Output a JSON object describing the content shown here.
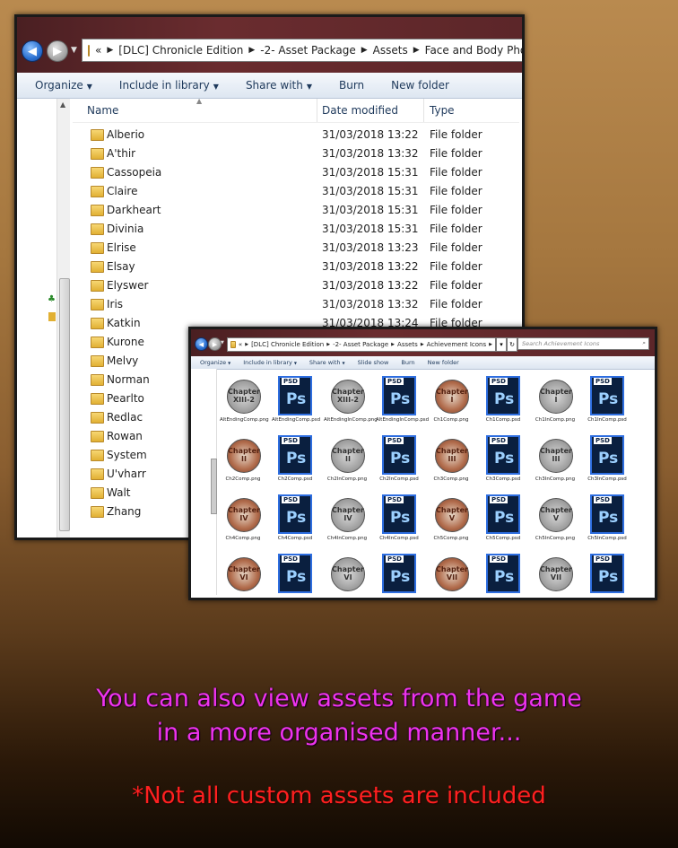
{
  "window1": {
    "path": [
      "«",
      "[DLC] Chronicle Edition",
      "-2- Asset Package",
      "Assets",
      "Face and Body Photos"
    ],
    "toolbar": [
      "Organize",
      "Include in library",
      "Share with",
      "Burn",
      "New folder"
    ],
    "columns": {
      "name": "Name",
      "date": "Date modified",
      "type": "Type"
    },
    "rows": [
      {
        "name": "Alberio",
        "date": "31/03/2018 13:22",
        "type": "File folder"
      },
      {
        "name": "A'thir",
        "date": "31/03/2018 13:32",
        "type": "File folder"
      },
      {
        "name": "Cassopeia",
        "date": "31/03/2018 15:31",
        "type": "File folder"
      },
      {
        "name": "Claire",
        "date": "31/03/2018 15:31",
        "type": "File folder"
      },
      {
        "name": "Darkheart",
        "date": "31/03/2018 15:31",
        "type": "File folder"
      },
      {
        "name": "Divinia",
        "date": "31/03/2018 15:31",
        "type": "File folder"
      },
      {
        "name": "Elrise",
        "date": "31/03/2018 13:23",
        "type": "File folder"
      },
      {
        "name": "Elsay",
        "date": "31/03/2018 13:22",
        "type": "File folder"
      },
      {
        "name": "Elyswer",
        "date": "31/03/2018 13:22",
        "type": "File folder"
      },
      {
        "name": "Iris",
        "date": "31/03/2018 13:32",
        "type": "File folder"
      },
      {
        "name": "Katkin",
        "date": "31/03/2018 13:24",
        "type": "File folder"
      },
      {
        "name": "Kurone",
        "date": "",
        "type": ""
      },
      {
        "name": "Melvy",
        "date": "",
        "type": ""
      },
      {
        "name": "Norman",
        "date": "",
        "type": ""
      },
      {
        "name": "Pearlto",
        "date": "",
        "type": ""
      },
      {
        "name": "Redlac",
        "date": "",
        "type": ""
      },
      {
        "name": "Rowan",
        "date": "",
        "type": ""
      },
      {
        "name": "System",
        "date": "",
        "type": ""
      },
      {
        "name": "U'vharr",
        "date": "",
        "type": ""
      },
      {
        "name": "Walt",
        "date": "",
        "type": ""
      },
      {
        "name": "Zhang",
        "date": "",
        "type": ""
      }
    ]
  },
  "window2": {
    "path": [
      "«",
      "[DLC] Chronicle Edition",
      "-2- Asset Package",
      "Assets",
      "Achievement Icons"
    ],
    "search_placeholder": "Search Achievement Icons",
    "toolbar": [
      "Organize",
      "Include in library",
      "Share with",
      "Slide show",
      "Burn",
      "New folder"
    ],
    "tiles": [
      {
        "kind": "chapter",
        "text": "Chapter XIII-2",
        "label": "AltEndingComp.png",
        "tone": "gray"
      },
      {
        "kind": "psd",
        "label": "AltEndingComp.psd"
      },
      {
        "kind": "chapter",
        "text": "Chapter XIII-2",
        "label": "AltEndingInComp.png",
        "tone": "gray"
      },
      {
        "kind": "psd",
        "label": "AltEndingInComp.psd"
      },
      {
        "kind": "chapter",
        "text": "Chapter I",
        "label": "Ch1Comp.png",
        "tone": "red"
      },
      {
        "kind": "psd",
        "label": "Ch1Comp.psd"
      },
      {
        "kind": "chapter",
        "text": "Chapter I",
        "label": "Ch1InComp.png",
        "tone": "gray"
      },
      {
        "kind": "psd",
        "label": "Ch1InComp.psd"
      },
      {
        "kind": "chapter",
        "text": "Chapter II",
        "label": "Ch2Comp.png",
        "tone": "red"
      },
      {
        "kind": "psd",
        "label": "Ch2Comp.psd"
      },
      {
        "kind": "chapter",
        "text": "Chapter II",
        "label": "Ch2InComp.png",
        "tone": "gray"
      },
      {
        "kind": "psd",
        "label": "Ch2InComp.psd"
      },
      {
        "kind": "chapter",
        "text": "Chapter III",
        "label": "Ch3Comp.png",
        "tone": "red"
      },
      {
        "kind": "psd",
        "label": "Ch3Comp.psd"
      },
      {
        "kind": "chapter",
        "text": "Chapter III",
        "label": "Ch3InComp.png",
        "tone": "gray"
      },
      {
        "kind": "psd",
        "label": "Ch3InComp.psd"
      },
      {
        "kind": "chapter",
        "text": "Chapter IV",
        "label": "Ch4Comp.png",
        "tone": "red"
      },
      {
        "kind": "psd",
        "label": "Ch4Comp.psd"
      },
      {
        "kind": "chapter",
        "text": "Chapter IV",
        "label": "Ch4InComp.png",
        "tone": "gray"
      },
      {
        "kind": "psd",
        "label": "Ch4InComp.psd"
      },
      {
        "kind": "chapter",
        "text": "Chapter V",
        "label": "Ch5Comp.png",
        "tone": "red"
      },
      {
        "kind": "psd",
        "label": "Ch5Comp.psd"
      },
      {
        "kind": "chapter",
        "text": "Chapter V",
        "label": "Ch5InComp.png",
        "tone": "gray"
      },
      {
        "kind": "psd",
        "label": "Ch5InComp.psd"
      },
      {
        "kind": "chapter",
        "text": "Chapter VI",
        "label": "",
        "tone": "red"
      },
      {
        "kind": "psd",
        "label": ""
      },
      {
        "kind": "chapter",
        "text": "Chapter VI",
        "label": "",
        "tone": "gray"
      },
      {
        "kind": "psd",
        "label": ""
      },
      {
        "kind": "chapter",
        "text": "Chapter VII",
        "label": "",
        "tone": "red"
      },
      {
        "kind": "psd",
        "label": ""
      },
      {
        "kind": "chapter",
        "text": "Chapter VII",
        "label": "",
        "tone": "gray"
      },
      {
        "kind": "psd",
        "label": ""
      }
    ]
  },
  "psd_badge": "PSD",
  "psd_letters": "Ps",
  "caption": {
    "line1": "You can also view assets from the game",
    "line2": "in a more organised manner...",
    "note": "*Not all custom assets are included"
  },
  "colors": {
    "caption": "#ee33ee",
    "note": "#ff2020"
  }
}
